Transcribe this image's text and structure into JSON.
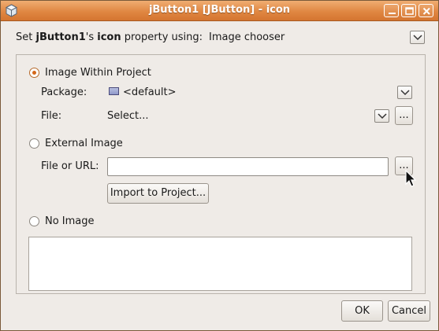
{
  "window": {
    "title": "jButton1 [JButton] - icon",
    "buttons": [
      "minimize",
      "maximize",
      "close"
    ]
  },
  "property_row": {
    "prefix": "Set ",
    "component": "jButton1",
    "possessive": "'s ",
    "property": "icon",
    "suffix": " property using:",
    "editor": "Image chooser"
  },
  "options": {
    "within_project": {
      "label": "Image Within Project",
      "selected": true,
      "package_label": "Package:",
      "package_value": "<default>",
      "file_label": "File:",
      "file_value": "Select...",
      "browse_label": "..."
    },
    "external": {
      "label": "External Image",
      "selected": false,
      "url_label": "File or URL:",
      "url_value": "",
      "browse_label": "...",
      "import_label": "Import to Project..."
    },
    "none": {
      "label": "No Image",
      "selected": false
    }
  },
  "footer": {
    "ok_label": "OK",
    "cancel_label": "Cancel"
  },
  "colors": {
    "titlebar": "#e08742",
    "radio_selected": "#d4681a",
    "window_bg": "#efebe7"
  },
  "icons": [
    "window-app-icon",
    "minimize-icon",
    "maximize-icon",
    "close-icon",
    "chevron-down-icon",
    "folder-icon",
    "mouse-cursor-icon"
  ]
}
